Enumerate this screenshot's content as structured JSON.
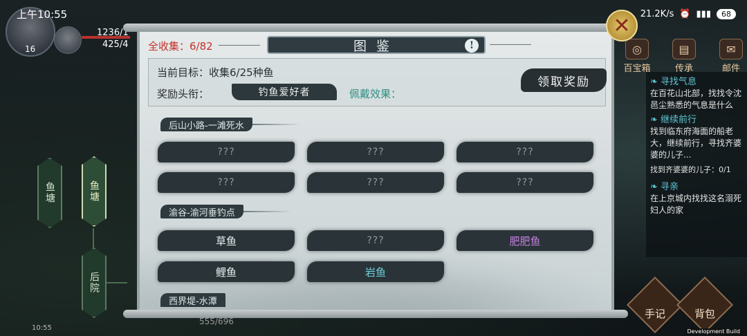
{
  "status": {
    "time": "上午10:55",
    "network": "21.2K/s",
    "battery": "68"
  },
  "player": {
    "level": "16",
    "hp": "1236/1",
    "mp": "425/4",
    "small_time": "10:55",
    "bottom_stat": "555/696"
  },
  "left_tree": [
    "鱼塘",
    "鱼塘",
    "后院"
  ],
  "right_menu": [
    "百宝箱",
    "传承",
    "邮件"
  ],
  "quests": [
    {
      "title": "寻找气息",
      "desc": "在百花山北部，找找令沈邑尘熟悉的气息是什么"
    },
    {
      "title": "继续前行",
      "desc": "找到临东府海面的船老大，继续前行，寻找齐婆婆的儿子...",
      "progress": "找到齐婆婆的儿子：0/1"
    },
    {
      "title": "寻亲",
      "desc": "在上京城内找找这名溺死妇人的家"
    }
  ],
  "bottom_buttons": [
    "手记",
    "背包"
  ],
  "dev_build": "Development Build",
  "codex": {
    "title": "图鉴",
    "total_label": "全收集：6/82",
    "goal_text": "当前目标：收集6/25种鱼",
    "reward_label": "奖励头衔：",
    "reward_title": "钓鱼爱好者",
    "wear_effect": "佩戴效果：",
    "claim_button": "领取奖励",
    "sections": [
      {
        "name": "后山小路-一滩死水",
        "fish": [
          {
            "name": "???",
            "style": "unknown"
          },
          {
            "name": "???",
            "style": "unknown"
          },
          {
            "name": "???",
            "style": "unknown"
          },
          {
            "name": "???",
            "style": "unknown"
          },
          {
            "name": "???",
            "style": "unknown"
          },
          {
            "name": "???",
            "style": "unknown"
          }
        ]
      },
      {
        "name": "渝谷-渝河垂钓点",
        "fish": [
          {
            "name": "草鱼",
            "style": "white"
          },
          {
            "name": "???",
            "style": "unknown"
          },
          {
            "name": "肥肥鱼",
            "style": "purple"
          },
          {
            "name": "鲤鱼",
            "style": "white"
          },
          {
            "name": "岩鱼",
            "style": "blue"
          }
        ]
      },
      {
        "name": "西界堤-水潭"
      }
    ]
  }
}
